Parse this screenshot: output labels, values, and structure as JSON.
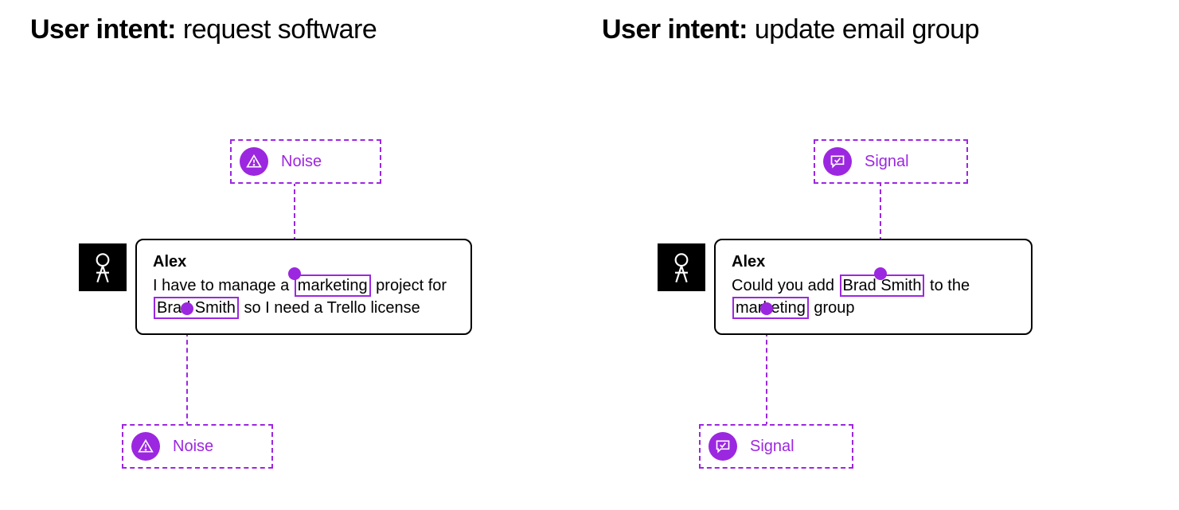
{
  "colors": {
    "purple": "#9c27e0"
  },
  "left": {
    "title_bold": "User intent:",
    "title_light": "request software",
    "tag_top": "Noise",
    "tag_bottom": "Noise",
    "speaker": "Alex",
    "msg_pre": "I have to manage a ",
    "msg_hl1": "marketing",
    "msg_mid": " project for ",
    "msg_hl2": "Brad Smith",
    "msg_post": " so I need a Trello license",
    "tag_icon": "alert"
  },
  "right": {
    "title_bold": "User intent:",
    "title_light": "update email group",
    "tag_top": "Signal",
    "tag_bottom": "Signal",
    "speaker": "Alex",
    "msg_pre": "Could you add ",
    "msg_hl1": "Brad Smith",
    "msg_mid": " to the ",
    "msg_hl2": "marketing",
    "msg_post": " group",
    "tag_icon": "chat-check"
  }
}
